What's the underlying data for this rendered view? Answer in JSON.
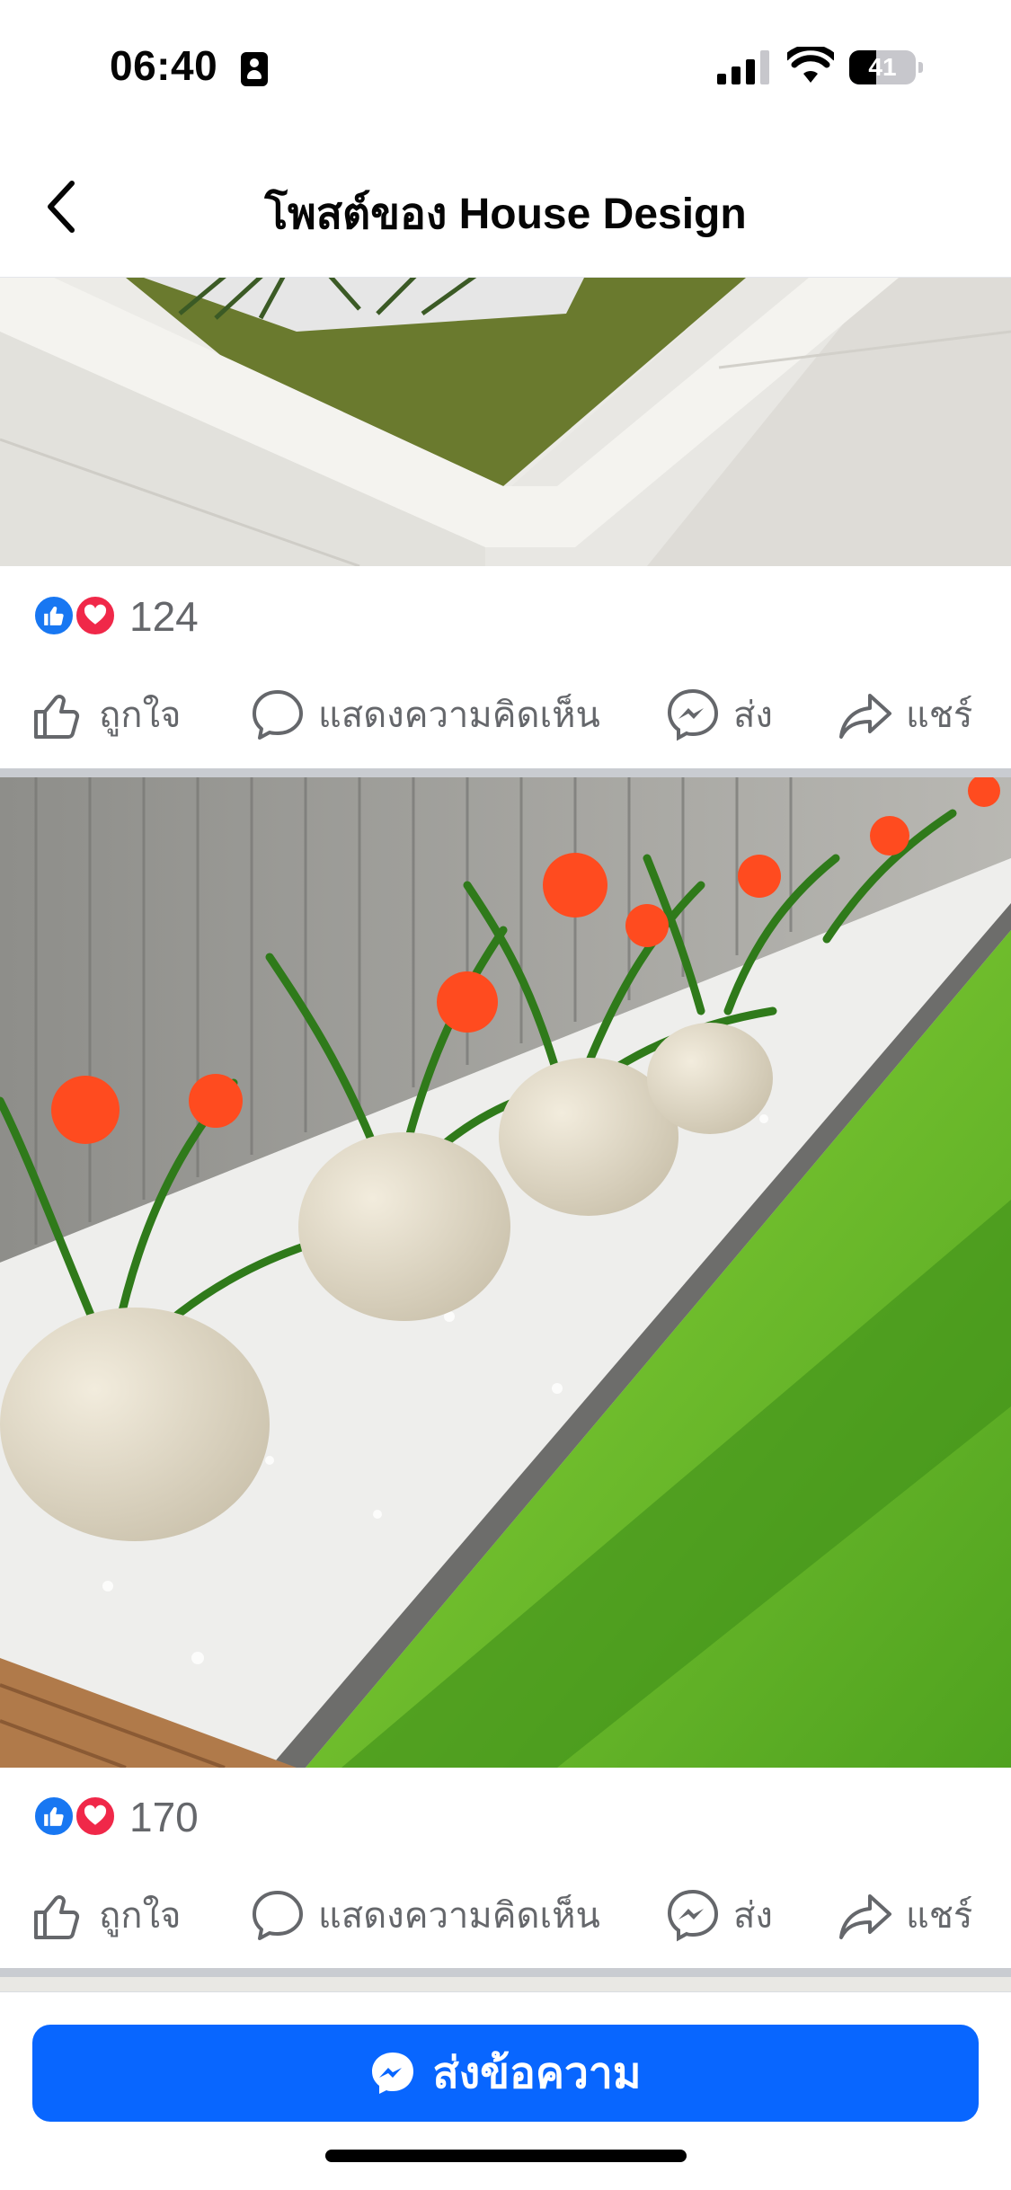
{
  "status_bar": {
    "time": "06:40",
    "battery": "41",
    "battery_level": 0.41
  },
  "header": {
    "title": "โพสต์ของ House Design",
    "back_icon": "chevron-left-icon"
  },
  "posts": [
    {
      "reaction_count": "124",
      "actions": {
        "like": "ถูกใจ",
        "comment": "แสดงความคิดเห็น",
        "send": "ส่ง",
        "share": "แชร์"
      }
    },
    {
      "reaction_count": "170",
      "actions": {
        "like": "ถูกใจ",
        "comment": "แสดงความคิดเห็น",
        "send": "ส่ง",
        "share": "แชร์"
      }
    }
  ],
  "bottom_bar": {
    "send_message_label": "ส่งข้อความ",
    "icon": "messenger-icon"
  },
  "colors": {
    "accent": "#0866ff",
    "like": "#1877f2",
    "love": "#f02849",
    "secondary_text": "#65676b"
  }
}
